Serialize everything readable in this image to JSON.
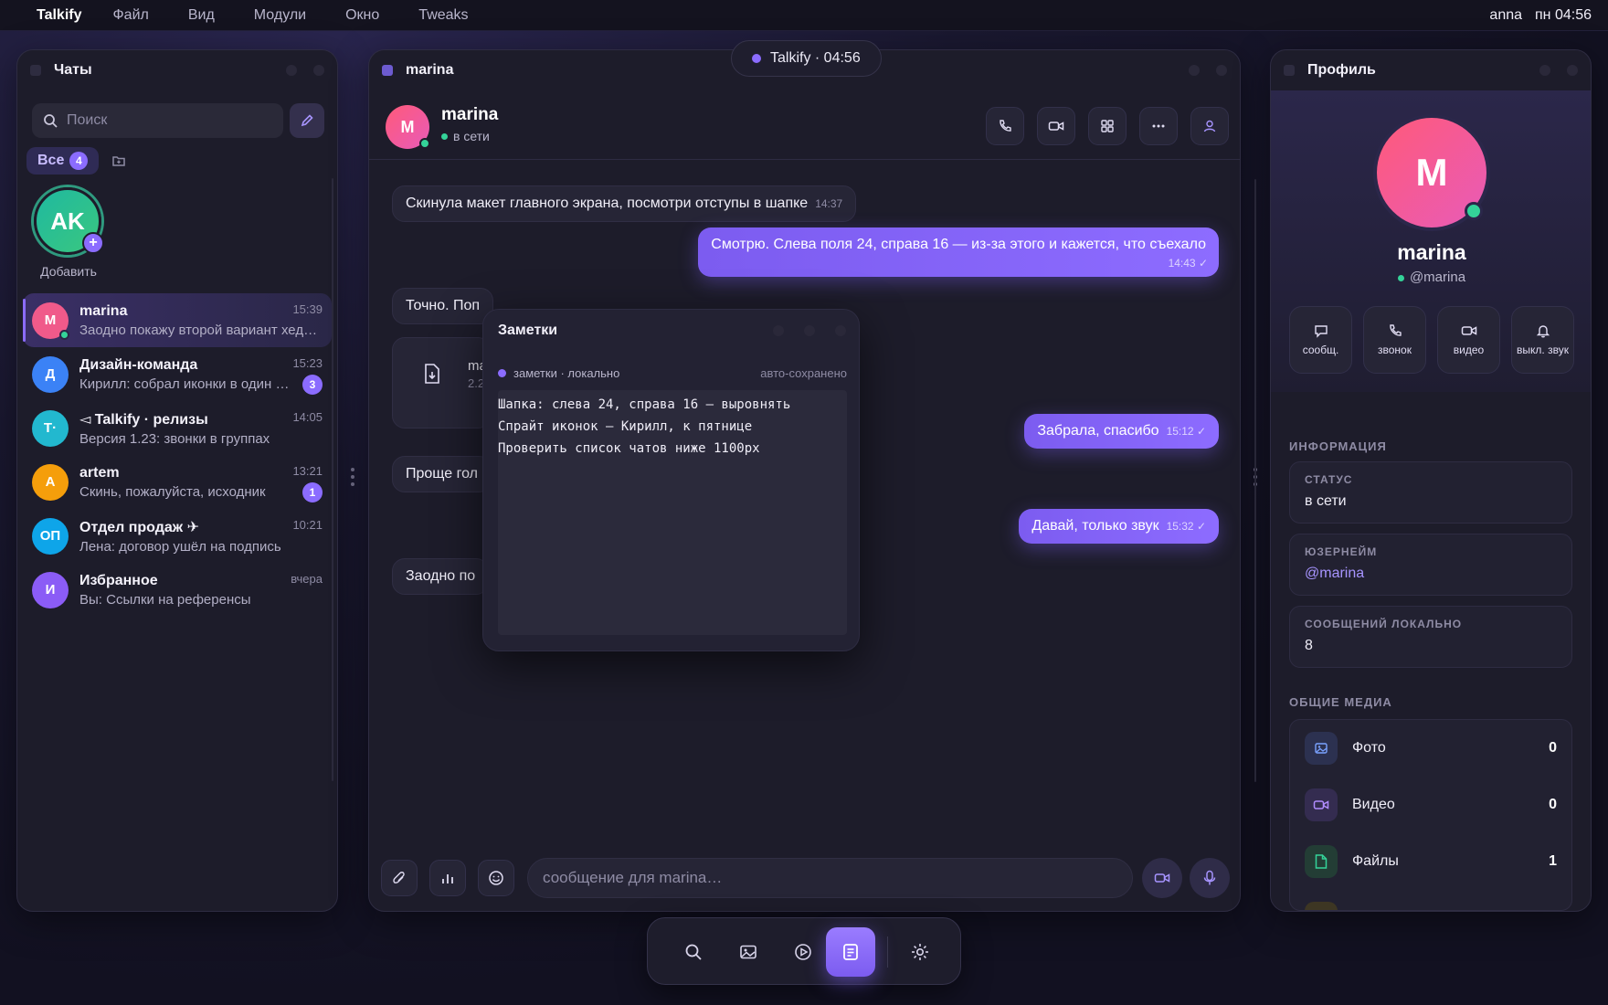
{
  "menubar": {
    "app": "Talkify",
    "items": [
      "Файл",
      "Вид",
      "Модули",
      "Окно",
      "Tweaks"
    ],
    "user": "anna",
    "clock": "пн 04:56"
  },
  "status_pill": {
    "label": "Talkify · 04:56"
  },
  "chats": {
    "title": "Чаты",
    "search_placeholder": "Поиск",
    "filter": {
      "label": "Все",
      "count": "4"
    },
    "story": {
      "initials": "AK",
      "label": "Добавить"
    },
    "items": [
      {
        "initials": "M",
        "name": "marina",
        "preview": "Заодно покажу второй вариант хедера",
        "time": "15:39",
        "badge": "",
        "color": "#f05a8a"
      },
      {
        "initials": "Д",
        "name": "Дизайн-команда",
        "preview": "Кирилл: собрал иконки в один спрайт",
        "time": "15:23",
        "badge": "3",
        "color": "#3b82f6"
      },
      {
        "initials": "T·",
        "name": "◅ Talkify · релизы",
        "preview": "Версия 1.23: звонки в группах",
        "time": "14:05",
        "badge": "",
        "color": "#22b8cf"
      },
      {
        "initials": "A",
        "name": "artem",
        "preview": "Скинь, пожалуйста, исходник",
        "time": "13:21",
        "badge": "1",
        "color": "#f59e0b"
      },
      {
        "initials": "ОП",
        "name": "Отдел продаж ✈",
        "preview": "Лена: договор ушёл на подпись",
        "time": "10:21",
        "badge": "",
        "color": "#0ea5e9"
      },
      {
        "initials": "И",
        "name": "Избранное",
        "preview": "Вы: Ссылки на референсы",
        "time": "вчера",
        "badge": "",
        "color": "#8b5cf6"
      }
    ]
  },
  "main": {
    "title": "marina",
    "contact": {
      "initials": "M",
      "name": "marina",
      "status": "в сети"
    },
    "messages": [
      {
        "dir": "in",
        "text": "Скинула макет главного экрана, посмотри отступы в шапке",
        "time": "14:37"
      },
      {
        "dir": "out",
        "text": "Смотрю. Слева поля 24, справа 16 — из-за этого и кажется, что съехало",
        "time": "14:43 ✓"
      },
      {
        "dir": "in",
        "text": "Точно. Поп",
        "time": ""
      },
      {
        "dir": "file",
        "name": "ma",
        "size": "2.2"
      },
      {
        "dir": "out",
        "text": "Забрала, спасибо",
        "time": "15:12 ✓"
      },
      {
        "dir": "in",
        "text": "Проще гол",
        "time": ""
      },
      {
        "dir": "out",
        "text": "Давай, только звук",
        "time": "15:32 ✓"
      },
      {
        "dir": "in",
        "text": "Заодно по",
        "time": ""
      }
    ],
    "composer_placeholder": "сообщение для marina…"
  },
  "notes": {
    "title": "Заметки",
    "meta_left": "заметки · локально",
    "meta_right": "авто-сохранено",
    "content": "Шапка: слева 24, справа 16 — выровнять\nСпрайт иконок — Кирилл, к пятнице\nПроверить список чатов ниже 1100px"
  },
  "profile": {
    "title": "Профиль",
    "initials": "M",
    "name": "marina",
    "username": "@marina",
    "actions": [
      "сообщ.",
      "звонок",
      "видео",
      "выкл. звук"
    ],
    "info_title": "ИНФОРМАЦИЯ",
    "status_label": "СТАТУС",
    "status_value": "в сети",
    "username_label": "ЮЗЕРНЕЙМ",
    "username_value": "@marina",
    "messages_label": "СООБЩЕНИЙ ЛОКАЛЬНО",
    "messages_value": "8",
    "media_title": "ОБЩИЕ МЕДИА",
    "media": [
      {
        "label": "Фото",
        "count": "0"
      },
      {
        "label": "Видео",
        "count": "0"
      },
      {
        "label": "Файлы",
        "count": "1"
      }
    ]
  },
  "colors": {
    "accent": "#8b6cff",
    "online": "#34d399",
    "window": "#1d1c2a"
  }
}
